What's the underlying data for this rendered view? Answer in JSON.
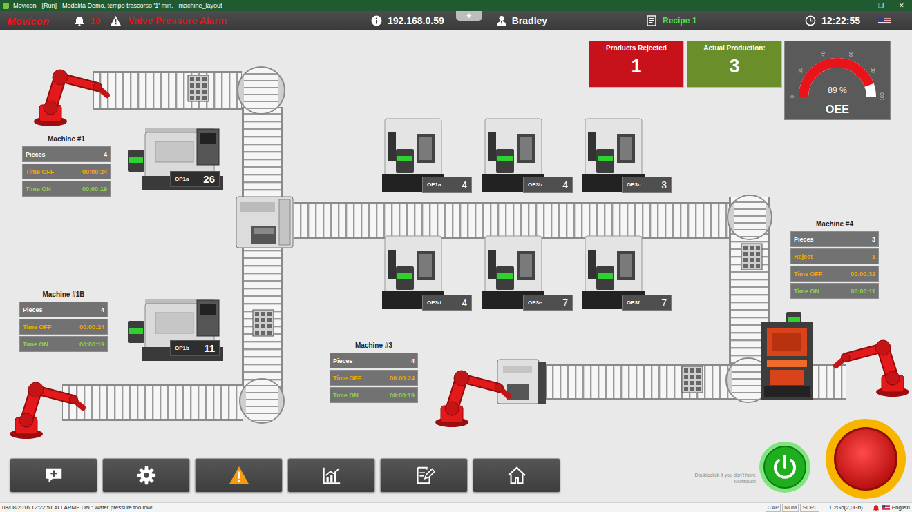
{
  "window": {
    "title": "Movicon - [Run] - Modalità Demo, tempo trascorso '1' min. - machine_layout",
    "controls": [
      "—",
      "❐",
      "✕"
    ]
  },
  "header": {
    "logo": "Movicon",
    "alarm_count": "10",
    "alarm_text": "Valve Pressure Alarm",
    "ip": "192.168.0.59",
    "tab_button": "+",
    "user": "Bradley",
    "recipe": "Recipe 1",
    "clock": "12:22:55"
  },
  "kpis": [
    {
      "label": "Products Rejected",
      "value": "1",
      "color": "#c8121b"
    },
    {
      "label": "Actual Production:",
      "value": "3",
      "color": "#6a8f2a"
    }
  ],
  "oee": {
    "label": "OEE",
    "reading": "89 %",
    "level": 0.89,
    "ticks": [
      "0",
      "20",
      "40",
      "60",
      "80",
      "100"
    ]
  },
  "machines": [
    {
      "title": "Machine #1",
      "rows": [
        {
          "label": "Pieces",
          "value": "4",
          "color": "#ffffff"
        },
        {
          "label": "Time OFF",
          "value": "00:00:24",
          "color": "#f5a800"
        },
        {
          "label": "Time ON",
          "value": "00:00:19",
          "color": "#8fd14f"
        }
      ]
    },
    {
      "title": "Machine #1B",
      "rows": [
        {
          "label": "Pieces",
          "value": "4",
          "color": "#ffffff"
        },
        {
          "label": "Time OFF",
          "value": "00:00:24",
          "color": "#f5a800"
        },
        {
          "label": "Time ON",
          "value": "00:00:19",
          "color": "#8fd14f"
        }
      ]
    },
    {
      "title": "Machine #3",
      "rows": [
        {
          "label": "Pieces",
          "value": "4",
          "color": "#ffffff"
        },
        {
          "label": "Time OFF",
          "value": "00:00:24",
          "color": "#f5a800"
        },
        {
          "label": "Time ON",
          "value": "00:00:19",
          "color": "#8fd14f"
        }
      ]
    },
    {
      "title": "Machine #4",
      "rows": [
        {
          "label": "Pieces",
          "value": "3",
          "color": "#ffffff"
        },
        {
          "label": "Reject",
          "value": "1",
          "color": "#f5a800"
        },
        {
          "label": "Time OFF",
          "value": "00:00:32",
          "color": "#f5a800"
        },
        {
          "label": "Time ON",
          "value": "00:00:11",
          "color": "#8fd14f"
        }
      ]
    }
  ],
  "stations": [
    {
      "label": "OP1a",
      "count": "26",
      "kind": "lathe"
    },
    {
      "label": "OP1b",
      "count": "11",
      "kind": "lathe"
    },
    {
      "label": "OP1a",
      "count": "4",
      "kind": "cnc"
    },
    {
      "label": "OP3b",
      "count": "4",
      "kind": "cnc"
    },
    {
      "label": "OP3c",
      "count": "3",
      "kind": "cnc"
    },
    {
      "label": "OP3d",
      "count": "4",
      "kind": "cnc"
    },
    {
      "label": "OP3e",
      "count": "7",
      "kind": "cnc"
    },
    {
      "label": "OP3f",
      "count": "7",
      "kind": "cnc"
    }
  ],
  "controls": {
    "hint": "Doubleclick if you don't have Multitouch"
  },
  "status_bar": {
    "message": "08/08/2016 12:22:51 ALLARME ON : Water pressure too low!",
    "indicators": [
      "CAP",
      "NUM",
      "SCRL"
    ],
    "memory": "1,2Gb(2,0Gb)",
    "language": "English"
  }
}
